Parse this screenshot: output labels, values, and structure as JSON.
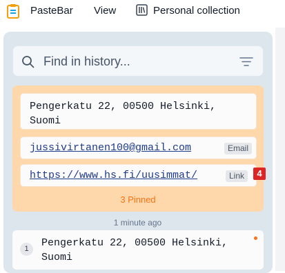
{
  "menubar": {
    "app_name": "PasteBar",
    "view_label": "View",
    "collection_label": "Personal collection",
    "logo_icon": "clipboard-logo-icon",
    "collection_icon": "library-icon"
  },
  "search": {
    "placeholder": "Find in history...",
    "value": "",
    "search_icon": "search-icon",
    "filter_icon": "filter-lines-icon"
  },
  "pinned": {
    "items": [
      {
        "text": "Pengerkatu 22, 00500 Helsinki, Suomi",
        "tag": ""
      },
      {
        "text": "jussivirtanen100@gmail.com",
        "tag": "Email"
      },
      {
        "text": "https://www.hs.fi/uusimmat/",
        "tag": "Link"
      }
    ],
    "count_label": "3 Pinned",
    "badge": "4",
    "background": "#fed7aa"
  },
  "history": {
    "timestamp": "1 minute ago",
    "items": [
      {
        "index": "1",
        "text": "Pengerkatu 22, 00500 Helsinki, Suomi"
      }
    ]
  },
  "colors": {
    "accent": "#f97316",
    "badge": "#dc2626",
    "panel": "#dde5ed"
  }
}
